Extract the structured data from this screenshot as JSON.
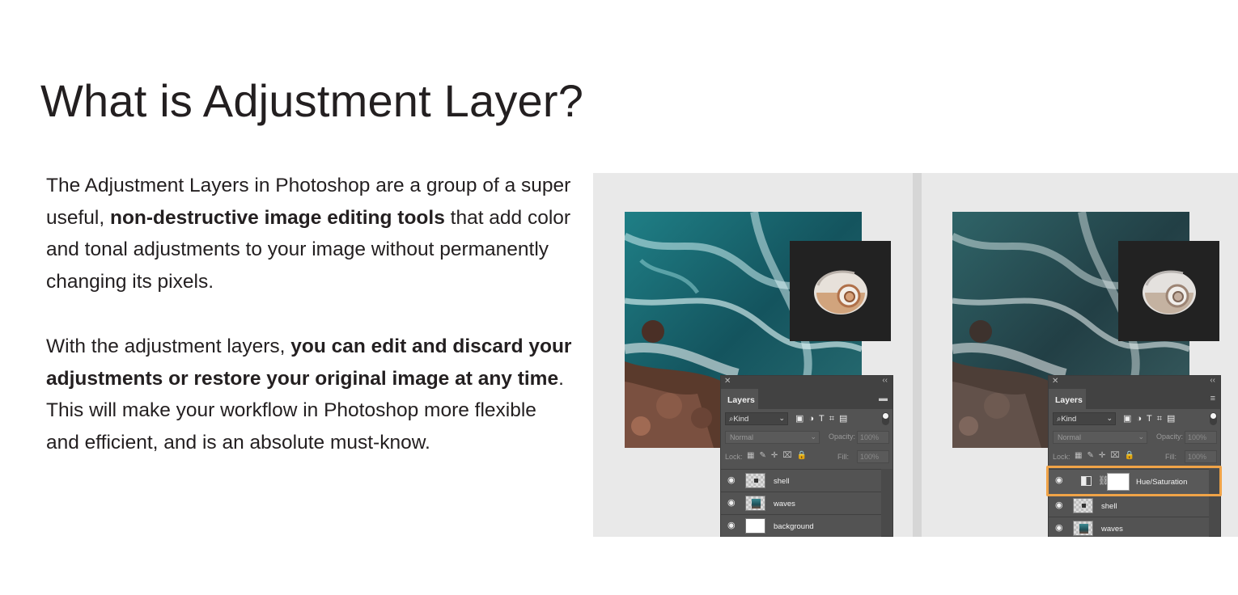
{
  "heading": "What is Adjustment Layer?",
  "paragraph1": {
    "t1": "The Adjustment Layers in Photoshop are a group of a super useful, ",
    "b1": "non-destructive image editing tools",
    "t2": " that add color and tonal adjustments to your image without permanently changing its pixels."
  },
  "paragraph2": {
    "t1": "With the adjustment layers, ",
    "b1": "you can edit and discard your adjustments or restore your original image at any time",
    "t2": ". This will make your workflow in Photoshop more flexible and efficient, and is an absolute must-know."
  },
  "figure": {
    "panel": {
      "title": "Layers",
      "kind": "Kind",
      "blend_mode": "Normal",
      "opacity_label": "Opacity:",
      "opacity_value": "100%",
      "lock_label": "Lock:",
      "fill_label": "Fill:",
      "fill_value": "100%"
    },
    "left_layers": [
      "shell",
      "waves",
      "background"
    ],
    "right_layers": [
      "Hue/Saturation",
      "shell",
      "waves"
    ],
    "highlight_color": "#f0a347"
  }
}
